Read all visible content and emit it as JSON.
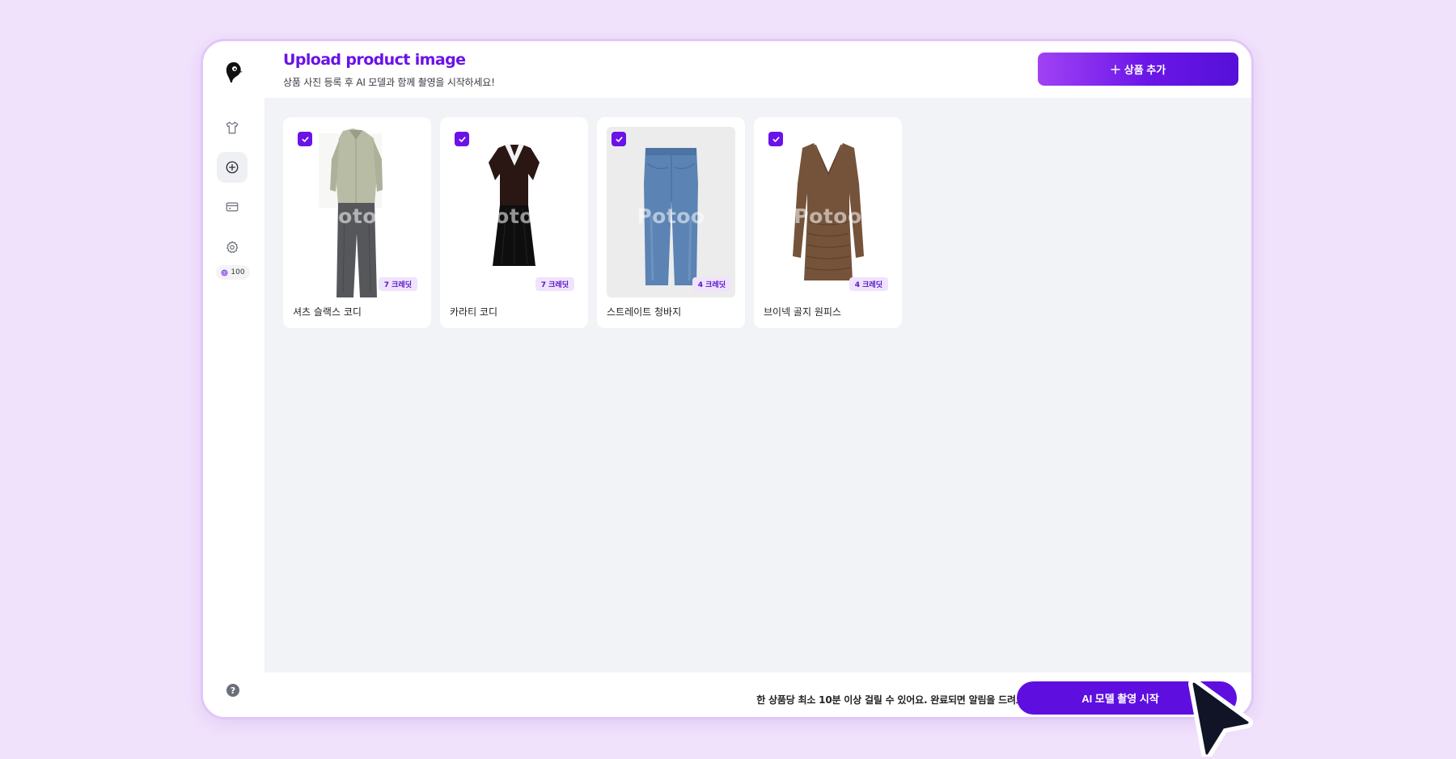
{
  "header": {
    "title": "Upload product image",
    "subtitle": "상품 사진 등록 후 AI 모델과 함께 촬영을 시작하세요!",
    "add_button_label": "상품 추가"
  },
  "sidebar": {
    "items": [
      {
        "name": "products",
        "icon": "tshirt-icon",
        "active": false
      },
      {
        "name": "add",
        "icon": "plus-circle-icon",
        "active": true
      },
      {
        "name": "billing",
        "icon": "credit-card-icon",
        "active": false
      },
      {
        "name": "settings",
        "icon": "gear-icon",
        "active": false
      }
    ],
    "credits": "100",
    "help_label": "?"
  },
  "products": [
    {
      "name": "셔츠 슬랙스 코디",
      "credits": "7 크레딧",
      "checked": true
    },
    {
      "name": "카라티 코디",
      "credits": "7 크레딧",
      "checked": true
    },
    {
      "name": "스트레이트 청바지",
      "credits": "4 크레딧",
      "checked": true
    },
    {
      "name": "브이넥 골지 원피스",
      "credits": "4 크레딧",
      "checked": true
    }
  ],
  "watermark": "Potoo",
  "footer": {
    "notice": "한 상품당 최소 10분 이상 걸릴 수 있어요. 완료되면 알림을 드려요.",
    "start_button_label": "AI 모델 촬영 시작"
  },
  "colors": {
    "accent": "#6a12e8",
    "background": "#f1e2fc",
    "badge_bg": "#efe3fd"
  }
}
